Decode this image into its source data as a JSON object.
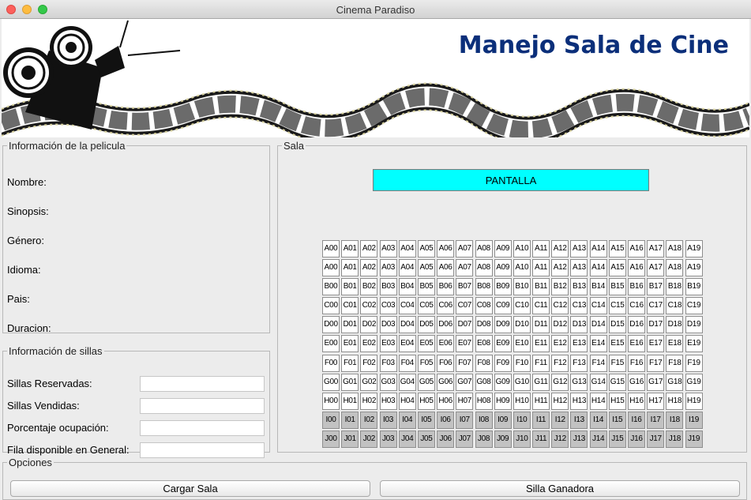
{
  "window": {
    "title": "Cinema Paradiso"
  },
  "banner": {
    "title": "Manejo Sala de Cine"
  },
  "movie_info": {
    "legend": "Información de la pelicula",
    "fields": [
      "Nombre:",
      "Sinopsis:",
      "Género:",
      "Idioma:",
      "Pais:",
      "Duracion:"
    ]
  },
  "seat_info": {
    "legend": "Información de sillas",
    "fields": [
      {
        "label": "Sillas Reservadas:",
        "value": ""
      },
      {
        "label": "Sillas Vendidas:",
        "value": ""
      },
      {
        "label": "Porcentaje ocupación:",
        "value": ""
      },
      {
        "label": "Fila disponible en General:",
        "value": ""
      }
    ]
  },
  "sala": {
    "legend": "Sala",
    "screen_label": "PANTALLA",
    "rows": [
      {
        "letter": "A",
        "status": "available"
      },
      {
        "letter": "A",
        "status": "available"
      },
      {
        "letter": "B",
        "status": "available"
      },
      {
        "letter": "C",
        "status": "available"
      },
      {
        "letter": "D",
        "status": "available"
      },
      {
        "letter": "E",
        "status": "available"
      },
      {
        "letter": "F",
        "status": "available"
      },
      {
        "letter": "G",
        "status": "available"
      },
      {
        "letter": "H",
        "status": "available"
      },
      {
        "letter": "I",
        "status": "occupied"
      },
      {
        "letter": "J",
        "status": "occupied"
      }
    ],
    "seats_per_row": 20,
    "occupied_color": "#c2c2c2",
    "screen_color": "#00ffff"
  },
  "options": {
    "legend": "Opciones",
    "load_button": "Cargar Sala",
    "winner_button": "Silla Ganadora"
  },
  "colors": {
    "title": "#0b2f7a"
  },
  "icons": [
    "film-projector-icon",
    "film-strip-icon"
  ]
}
